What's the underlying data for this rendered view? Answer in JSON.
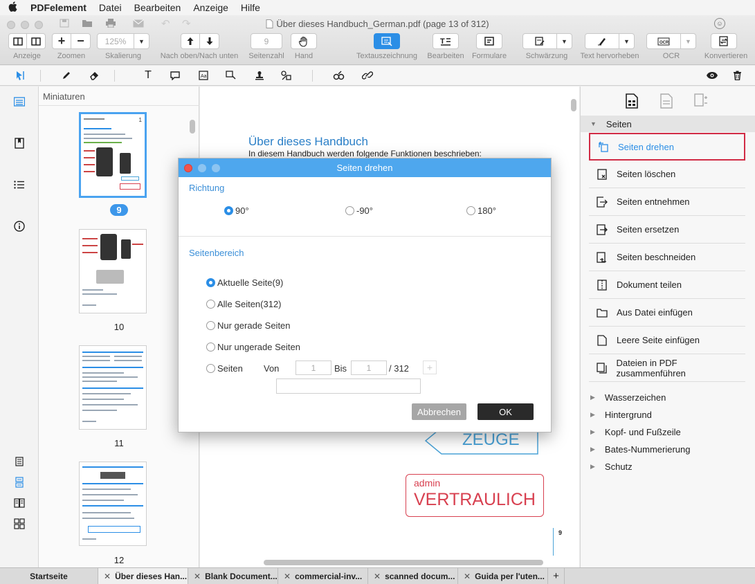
{
  "menubar": {
    "apple": "",
    "app": "PDFelement",
    "menus": [
      "Datei",
      "Bearbeiten",
      "Anzeige",
      "Hilfe"
    ]
  },
  "window": {
    "title": "Über dieses Handbuch_German.pdf (page 13 of 312)"
  },
  "toolbar": {
    "zoom_value": "125%",
    "page_value": "9",
    "labels": {
      "view": "Anzeige",
      "zoom": "Zoomen",
      "scale": "Skalierung",
      "updown": "Nach oben/Nach unten",
      "pagecount": "Seitenzahl",
      "hand": "Hand",
      "textmark": "Textauszeichnung",
      "edit": "Bearbeiten",
      "forms": "Formulare",
      "redact": "Schwärzung",
      "highlight": "Text hervorheben",
      "ocr": "OCR",
      "convert": "Konvertieren"
    }
  },
  "thumbs": {
    "header": "Miniaturen",
    "pages": [
      "9",
      "10",
      "11",
      "12"
    ]
  },
  "document": {
    "heading": "Über dieses Handbuch",
    "intro": "In diesem Handbuch werden folgende Funktionen beschrieben:",
    "stamp1": "ZEUGE",
    "stamp2_small": "admin",
    "stamp2_big": "VERTRAULICH",
    "page_num": "9"
  },
  "right_panel": {
    "section": "Seiten",
    "items": [
      "Seiten drehen",
      "Seiten löschen",
      "Seiten entnehmen",
      "Seiten ersetzen",
      "Seiten beschneiden",
      "Dokument teilen",
      "Aus Datei einfügen",
      "Leere Seite einfügen",
      "Dateien in PDF zusammenführen"
    ],
    "collapsed": [
      "Wasserzeichen",
      "Hintergrund",
      "Kopf- und Fußzeile",
      "Bates-Nummerierung",
      "Schutz"
    ]
  },
  "dialog": {
    "title": "Seiten drehen",
    "direction_label": "Richtung",
    "directions": [
      "90°",
      "-90°",
      "180°"
    ],
    "range_label": "Seitenbereich",
    "ranges": [
      "Aktuelle Seite(9)",
      "Alle Seiten(312)",
      "Nur gerade Seiten",
      "Nur ungerade Seiten",
      "Seiten"
    ],
    "from_label": "Von",
    "from_value": "1",
    "to_label": "Bis",
    "to_value": "1",
    "total": "/ 312",
    "plus": "+",
    "cancel": "Abbrechen",
    "ok": "OK"
  },
  "tabs": [
    "Startseite",
    "Über dieses Han...",
    "Blank Document...",
    "commercial-inv...",
    "scanned docum...",
    "Guida per l'uten..."
  ],
  "tab_add": "+",
  "colors": {
    "accent": "#2b8ee6",
    "dialog_title": "#4ea7ee",
    "highlight_border": "#d12b45",
    "stamp_blue": "#4aa3d8",
    "stamp_red": "#d84050"
  }
}
